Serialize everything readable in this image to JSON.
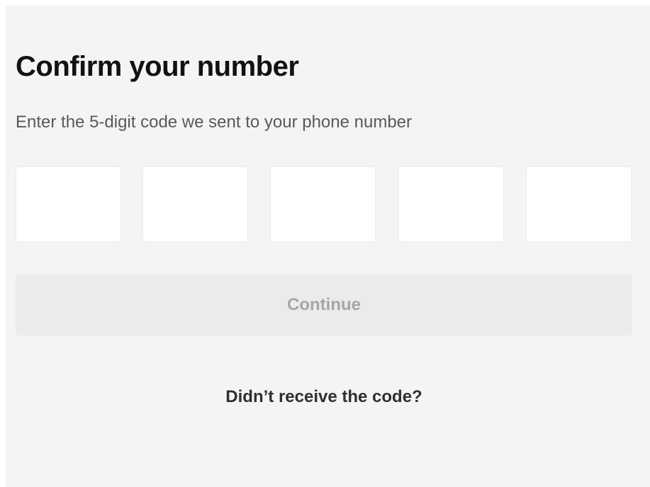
{
  "form": {
    "title": "Confirm your number",
    "subtitle": "Enter the 5-digit code we sent to your phone number",
    "code_digits": [
      "",
      "",
      "",
      "",
      ""
    ],
    "continue_label": "Continue",
    "resend_label": "Didn’t receive the code?"
  },
  "colors": {
    "panel_background": "#f4f4f4",
    "input_background": "#ffffff",
    "button_disabled_background": "#ebebeb",
    "button_disabled_text": "#a6a6a6",
    "title_text": "#121212",
    "subtitle_text": "#545a5c",
    "link_text": "#2b3133"
  }
}
